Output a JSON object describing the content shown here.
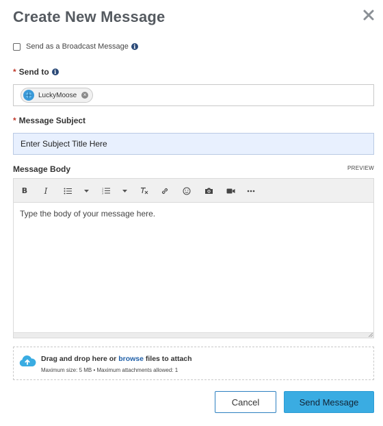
{
  "dialog": {
    "title": "Create New Message"
  },
  "broadcast": {
    "label": "Send as a Broadcast Message",
    "checked": false
  },
  "send_to": {
    "label": "Send to",
    "recipients": [
      {
        "name": "LuckyMoose"
      }
    ]
  },
  "subject": {
    "label": "Message Subject",
    "value": "Enter Subject Title Here"
  },
  "body": {
    "label": "Message Body",
    "preview_label": "PREVIEW",
    "placeholder": "Type the body of your message here.",
    "toolbar": [
      "bold-icon",
      "italic-icon",
      "bulleted-list-icon",
      "chevron-down-icon",
      "numbered-list-icon",
      "chevron-down-icon",
      "clear-formatting-icon",
      "link-icon",
      "emoji-icon",
      "camera-icon",
      "video-icon",
      "more-icon"
    ]
  },
  "attachments": {
    "text_before": "Drag and drop here or",
    "browse_link": "browse",
    "text_after": "files to attach",
    "limits": "Maximum size: 5 MB • Maximum attachments allowed: 1"
  },
  "actions": {
    "cancel": "Cancel",
    "send": "Send Message"
  },
  "colors": {
    "accent": "#3aace2",
    "link": "#1f5fa8",
    "required": "#c0392b",
    "title": "#555a60"
  }
}
